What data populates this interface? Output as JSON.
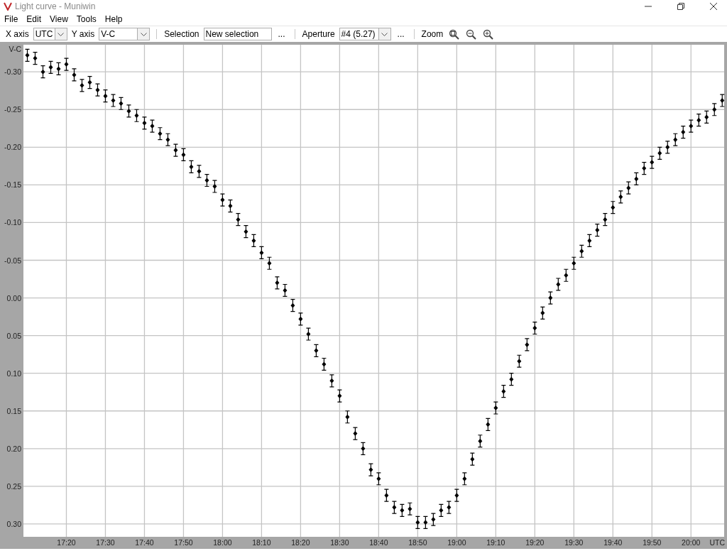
{
  "window": {
    "title": "Light curve - Muniwin"
  },
  "menu": [
    {
      "label": "File"
    },
    {
      "label": "Edit"
    },
    {
      "label": "View"
    },
    {
      "label": "Tools"
    },
    {
      "label": "Help"
    }
  ],
  "toolbar": {
    "x_axis": {
      "label": "X axis",
      "value": "UTC"
    },
    "y_axis": {
      "label": "Y axis",
      "value": "V-C"
    },
    "selection": {
      "label": "Selection",
      "value": "New selection",
      "more": "..."
    },
    "aperture": {
      "label": "Aperture",
      "value": "#4 (5.27)",
      "more": "..."
    },
    "zoom_label": "Zoom"
  },
  "chart": {
    "chart_data": {
      "type": "scatter",
      "xlabel": "UTC",
      "ylabel": "V-C",
      "x": [
        1030,
        1032,
        1034,
        1036,
        1038,
        1040,
        1042,
        1044,
        1046,
        1048,
        1050,
        1052,
        1054,
        1056,
        1058,
        1060,
        1062,
        1064,
        1066,
        1068,
        1070,
        1072,
        1074,
        1076,
        1078,
        1080,
        1082,
        1084,
        1086,
        1088,
        1090,
        1092,
        1094,
        1096,
        1098,
        1100,
        1102,
        1104,
        1106,
        1108,
        1110,
        1112,
        1114,
        1116,
        1118,
        1120,
        1122,
        1124,
        1126,
        1128,
        1130,
        1132,
        1134,
        1136,
        1138,
        1140,
        1142,
        1144,
        1146,
        1148,
        1150,
        1152,
        1154,
        1156,
        1158,
        1160,
        1162,
        1164,
        1166,
        1168,
        1170,
        1172,
        1174,
        1176,
        1178,
        1180,
        1182,
        1184,
        1186,
        1188,
        1190,
        1192,
        1194,
        1196,
        1198,
        1200,
        1202,
        1204,
        1206,
        1208
      ],
      "grid": true,
      "series": [
        {
          "color": "#000000",
          "errors": [
            0.008,
            0.008,
            0.008,
            0.008,
            0.008,
            0.008,
            0.008,
            0.008,
            0.008,
            0.008,
            0.008,
            0.008,
            0.008,
            0.008,
            0.008,
            0.008,
            0.008,
            0.008,
            0.008,
            0.008,
            0.008,
            0.008,
            0.008,
            0.008,
            0.008,
            0.008,
            0.008,
            0.008,
            0.008,
            0.008,
            0.008,
            0.008,
            0.008,
            0.008,
            0.008,
            0.008,
            0.008,
            0.008,
            0.008,
            0.008,
            0.008,
            0.008,
            0.008,
            0.008,
            0.008,
            0.008,
            0.008,
            0.008,
            0.008,
            0.008,
            0.008,
            0.008,
            0.008,
            0.008,
            0.008,
            0.008,
            0.008,
            0.008,
            0.008,
            0.008,
            0.008,
            0.008,
            0.008,
            0.008,
            0.008,
            0.008,
            0.008,
            0.008,
            0.008,
            0.008,
            0.008,
            0.008,
            0.008,
            0.008,
            0.008,
            0.008,
            0.008,
            0.008,
            0.008,
            0.008,
            0.008,
            0.008,
            0.008,
            0.008,
            0.008,
            0.008,
            0.008,
            0.008,
            0.008,
            0.008
          ],
          "values": [
            -0.322,
            -0.318,
            -0.3,
            -0.306,
            -0.304,
            -0.31,
            -0.296,
            -0.282,
            -0.286,
            -0.276,
            -0.268,
            -0.262,
            -0.258,
            -0.248,
            -0.242,
            -0.232,
            -0.228,
            -0.218,
            -0.21,
            -0.196,
            -0.19,
            -0.174,
            -0.168,
            -0.156,
            -0.148,
            -0.13,
            -0.122,
            -0.104,
            -0.088,
            -0.076,
            -0.06,
            -0.046,
            -0.02,
            -0.01,
            0.01,
            0.028,
            0.048,
            0.07,
            0.088,
            0.11,
            0.13,
            0.158,
            0.18,
            0.2,
            0.228,
            0.24,
            0.262,
            0.278,
            0.282,
            0.28,
            0.298,
            0.298,
            0.294,
            0.282,
            0.278,
            0.262,
            0.24,
            0.214,
            0.19,
            0.168,
            0.146,
            0.124,
            0.108,
            0.084,
            0.062,
            0.04,
            0.02,
            0.0,
            -0.018,
            -0.03,
            -0.046,
            -0.062,
            -0.076,
            -0.09,
            -0.104,
            -0.12,
            -0.134,
            -0.146,
            -0.158,
            -0.172,
            -0.18,
            -0.192,
            -0.2,
            -0.21,
            -0.22,
            -0.228,
            -0.236,
            -0.24,
            -0.25,
            -0.262
          ]
        }
      ],
      "xlim": [
        1029,
        1208.5
      ],
      "ylim": [
        0.317,
        -0.336
      ],
      "xticks": [
        {
          "value": 1040,
          "label": "17:20"
        },
        {
          "value": 1050,
          "label": "17:30"
        },
        {
          "value": 1060,
          "label": "17:40"
        },
        {
          "value": 1070,
          "label": "17:50"
        },
        {
          "value": 1080,
          "label": "18:00"
        },
        {
          "value": 1090,
          "label": "18:10"
        },
        {
          "value": 1100,
          "label": "18:20"
        },
        {
          "value": 1110,
          "label": "18:30"
        },
        {
          "value": 1120,
          "label": "18:40"
        },
        {
          "value": 1130,
          "label": "18:50"
        },
        {
          "value": 1140,
          "label": "19:00"
        },
        {
          "value": 1150,
          "label": "19:10"
        },
        {
          "value": 1160,
          "label": "19:20"
        },
        {
          "value": 1170,
          "label": "19:30"
        },
        {
          "value": 1180,
          "label": "19:40"
        },
        {
          "value": 1190,
          "label": "19:50"
        },
        {
          "value": 1200,
          "label": "20:00"
        }
      ],
      "yticks": [
        {
          "value": -0.3,
          "label": "-0.30"
        },
        {
          "value": -0.25,
          "label": "-0.25"
        },
        {
          "value": -0.2,
          "label": "-0.20"
        },
        {
          "value": -0.15,
          "label": "-0.15"
        },
        {
          "value": -0.1,
          "label": "-0.10"
        },
        {
          "value": -0.05,
          "label": "-0.05"
        },
        {
          "value": 0,
          "label": "0.00"
        },
        {
          "value": 0.05,
          "label": "0.05"
        },
        {
          "value": 0.1,
          "label": "0.10"
        },
        {
          "value": 0.15,
          "label": "0.15"
        },
        {
          "value": 0.2,
          "label": "0.20"
        },
        {
          "value": 0.25,
          "label": "0.25"
        },
        {
          "value": 0.3,
          "label": "0.30"
        }
      ]
    }
  }
}
